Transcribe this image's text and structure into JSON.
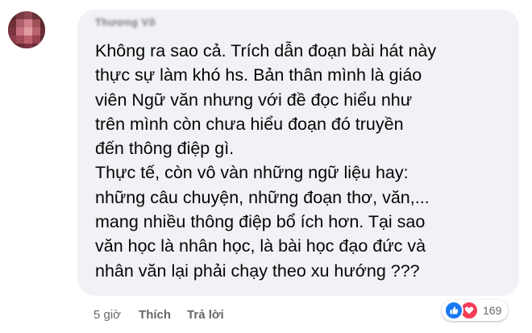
{
  "comment": {
    "author": "Thương Võ",
    "lines": [
      "Không ra sao cả. Trích dẫn đoạn bài hát này",
      "thực sự làm khó hs. Bản thân mình là giáo",
      "viên Ngữ văn nhưng với đề đọc hiểu như",
      "trên mình còn chưa hiểu đoạn đó truyền",
      "đến thông điệp gì.",
      "Thực tế, còn vô vàn những ngữ liệu hay:",
      "những câu chuyện, những đoạn thơ, văn,...",
      "mang nhiều thông điệp bổ ích hơn. Tại sao",
      "văn học là nhân học, là bài học đạo đức và",
      "nhân văn lại phải chạy theo xu hướng ???"
    ],
    "timestamp": "5 giờ",
    "like_label": "Thích",
    "reply_label": "Trả lời",
    "reactions": {
      "count": "169",
      "icons": [
        "like-icon",
        "love-icon"
      ]
    }
  },
  "colors": {
    "bubble": "#f0f2f5",
    "text": "#050505",
    "meta": "#65676b",
    "like": "#1877f2",
    "love": "#f33e58"
  }
}
